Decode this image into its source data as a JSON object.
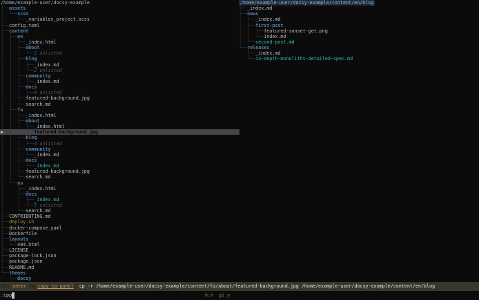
{
  "panels": {
    "left": {
      "path": "/home/example-user/docsy-example",
      "rows": [
        {
          "prefix": "├──",
          "name": "assets",
          "cls": "dir"
        },
        {
          "prefix": "│  └──",
          "name": "scss",
          "cls": "dir"
        },
        {
          "prefix": "│     └──",
          "name": "_variables_project.scss",
          "cls": "file"
        },
        {
          "prefix": "├──",
          "name": "config.toml",
          "cls": "file"
        },
        {
          "prefix": "├──",
          "name": "content",
          "cls": "dir"
        },
        {
          "prefix": "│  ├──",
          "name": "en",
          "cls": "dir"
        },
        {
          "prefix": "│  │  ├──",
          "name": "_index.html",
          "cls": "file"
        },
        {
          "prefix": "│  │  ├──",
          "name": "about",
          "cls": "dir"
        },
        {
          "prefix": "│  │  │  └──",
          "name": "2 unlisted",
          "cls": "unlisted"
        },
        {
          "prefix": "│  │  ├──",
          "name": "blog",
          "cls": "dir"
        },
        {
          "prefix": "│  │  │  ├──",
          "name": "_index.md",
          "cls": "file"
        },
        {
          "prefix": "│  │  │  └──",
          "name": "2 unlisted",
          "cls": "unlisted"
        },
        {
          "prefix": "│  │  ├──",
          "name": "community",
          "cls": "dir"
        },
        {
          "prefix": "│  │  │  └──",
          "name": "_index.md",
          "cls": "file"
        },
        {
          "prefix": "│  │  ├──",
          "name": "docs",
          "cls": "dir"
        },
        {
          "prefix": "│  │  │  └──",
          "name": "9 unlisted",
          "cls": "unlisted"
        },
        {
          "prefix": "│  │  ├──",
          "name": "featured-background.jpg",
          "cls": "file"
        },
        {
          "prefix": "│  │  └──",
          "name": "search.md",
          "cls": "file"
        },
        {
          "prefix": "│  ├──",
          "name": "fa",
          "cls": "dir"
        },
        {
          "prefix": "│  │  ├──",
          "name": "_index.html",
          "cls": "file"
        },
        {
          "prefix": "│  │  ├──",
          "name": "about",
          "cls": "dir"
        },
        {
          "prefix": "│  │  │  ├──",
          "name": "_index.html",
          "cls": "file"
        },
        {
          "prefix": "│  │  │  └──",
          "name": "featured-background.jpg",
          "cls": "file",
          "sel": "sel",
          "marker": "▶"
        },
        {
          "prefix": "│  │  ├──",
          "name": "blog",
          "cls": "dir"
        },
        {
          "prefix": "│  │  │  └──",
          "name": "3 unlisted",
          "cls": "unlisted"
        },
        {
          "prefix": "│  │  ├──",
          "name": "community",
          "cls": "dir"
        },
        {
          "prefix": "│  │  │  └──",
          "name": "_index.md",
          "cls": "file"
        },
        {
          "prefix": "│  │  ├──",
          "name": "docs",
          "cls": "dir"
        },
        {
          "prefix": "│  │  │  └──",
          "name": "_index.md",
          "cls": "cyan"
        },
        {
          "prefix": "│  │  ├──",
          "name": "featured-background.jpg",
          "cls": "file"
        },
        {
          "prefix": "│  │  └──",
          "name": "search.md",
          "cls": "file"
        },
        {
          "prefix": "│  └──",
          "name": "no",
          "cls": "dir"
        },
        {
          "prefix": "│     ├──",
          "name": "_index.html",
          "cls": "file"
        },
        {
          "prefix": "│     ├──",
          "name": "docs",
          "cls": "dir"
        },
        {
          "prefix": "│     │  ├──",
          "name": "_index.md",
          "cls": "cyan"
        },
        {
          "prefix": "│     │  └──",
          "name": "5 unlisted",
          "cls": "unlisted"
        },
        {
          "prefix": "│     └──",
          "name": "search.md",
          "cls": "file"
        },
        {
          "prefix": "├──",
          "name": "CONTRIBUTING.md",
          "cls": "file"
        },
        {
          "prefix": "├──",
          "name": "deploy.sh",
          "cls": "exec"
        },
        {
          "prefix": "├──",
          "name": "docker-compose.yaml",
          "cls": "file"
        },
        {
          "prefix": "├──",
          "name": "Dockerfile",
          "cls": "file"
        },
        {
          "prefix": "├──",
          "name": "layouts",
          "cls": "dir"
        },
        {
          "prefix": "│  └──",
          "name": "404.html",
          "cls": "file"
        },
        {
          "prefix": "├──",
          "name": "LICENSE",
          "cls": "file"
        },
        {
          "prefix": "├──",
          "name": "package-lock.json",
          "cls": "file"
        },
        {
          "prefix": "├──",
          "name": "package.json",
          "cls": "file"
        },
        {
          "prefix": "├──",
          "name": "README.md",
          "cls": "file"
        },
        {
          "prefix": "└──",
          "name": "themes",
          "cls": "dir"
        },
        {
          "prefix": "   └──",
          "name": "docsy",
          "cls": "dir"
        }
      ]
    },
    "right": {
      "path": "/home/example-user/docsy-example/content/en/blog",
      "rows": [
        {
          "prefix": "├──",
          "name": "_index.md",
          "cls": "file"
        },
        {
          "prefix": "├──",
          "name": "news",
          "cls": "dir"
        },
        {
          "prefix": "│  ├──",
          "name": "_index.md",
          "cls": "file"
        },
        {
          "prefix": "│  ├──",
          "name": "first-post",
          "cls": "dir"
        },
        {
          "prefix": "│  │  ├──",
          "name": "featured-sunset-get.png",
          "cls": "file"
        },
        {
          "prefix": "│  │  └──",
          "name": "index.md",
          "cls": "file"
        },
        {
          "prefix": "│  └──",
          "name": "second-post.md",
          "cls": "cyan"
        },
        {
          "prefix": "└──",
          "name": "releases",
          "cls": "dir"
        },
        {
          "prefix": "   ├──",
          "name": "_index.md",
          "cls": "file"
        },
        {
          "prefix": "   └──",
          "name": "in-depth-monoliths-detailed-spec.md",
          "cls": "cyan"
        }
      ]
    }
  },
  "status_bar": {
    "hint_prefix": "Hit ",
    "key": "enter",
    "hint_mid": " to ",
    "verb": "copy_to_panel",
    "separator": ": ",
    "command": "cp -r /home/example-user/docsy-example/content/fa/about/featured-background.jpg /home/example-user/docsy-example/content/en/blog"
  },
  "input": {
    "value": ":cpp"
  },
  "flags": "h:n  gi:y",
  "selection_marker": "▶",
  "colors": {
    "background": "#0b0b0b",
    "directory": "#5282ae",
    "file": "#bdbdbd",
    "changed_file_cyan": "#38b8b8",
    "unlisted_gray": "#575757",
    "executable_amber": "#b0923f",
    "selection_bg": "#464646",
    "status_bar_bg": "#37372e",
    "status_accent_orange": "#c89550",
    "focused_title_bg": "#1c2c3e",
    "tree_branch": "#3d3d3d"
  }
}
